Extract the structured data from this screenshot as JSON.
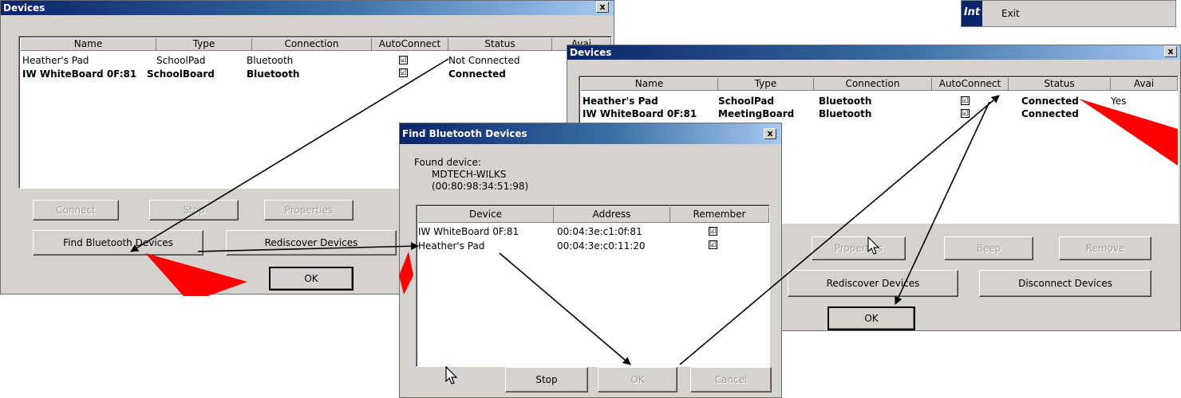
{
  "menu": {
    "strip_label": "Int",
    "item_label": "Exit"
  },
  "win1": {
    "title": "Devices",
    "close_glyph": "x",
    "columns": [
      "Name",
      "Type",
      "Connection",
      "AutoConnect",
      "Status",
      "Avai"
    ],
    "rows": [
      {
        "name": "Heather's Pad",
        "type": "SchoolPad",
        "connection": "Bluetooth",
        "auto": "☑",
        "status": "Not Connected",
        "bold": false
      },
      {
        "name": "IW WhiteBoard 0F:81",
        "type": "SchoolBoard",
        "connection": "Bluetooth",
        "auto": "☑",
        "status": "Connected",
        "bold": true
      }
    ],
    "buttons": {
      "connect": "Connect",
      "stop": "Stop",
      "properties": "Properties",
      "find": "Find Bluetooth Devices",
      "rediscover": "Rediscover Devices",
      "ok": "OK"
    }
  },
  "win2": {
    "title": "Devices",
    "close_glyph": "x",
    "columns": [
      "Name",
      "Type",
      "Connection",
      "AutoConnect",
      "Status",
      "Avai"
    ],
    "rows": [
      {
        "name": "Heather's Pad",
        "type": "SchoolPad",
        "connection": "Bluetooth",
        "auto": "☑",
        "status": "Connected",
        "avail": "Yes"
      },
      {
        "name": "IW WhiteBoard 0F:81",
        "type": "MeetingBoard",
        "connection": "Bluetooth",
        "auto": "☑",
        "status": "Connected",
        "avail": ""
      }
    ],
    "buttons": {
      "properties": "Properties",
      "beep": "Beep",
      "remove": "Remove",
      "rediscover": "Rediscover Devices",
      "disconnect": "Disconnect Devices",
      "ok": "OK"
    }
  },
  "win3": {
    "title": "Find Bluetooth Devices",
    "close_glyph": "x",
    "found_label": "Found device:",
    "found_name": "MDTECH-WILKS",
    "found_address": "(00:80:98:34:51:98)",
    "columns": [
      "Device",
      "Address",
      "Remember"
    ],
    "rows": [
      {
        "device": "IW WhiteBoard 0F:81",
        "address": "00:04:3e:c1:0f:81",
        "remember": "☑"
      },
      {
        "device": "Heather's Pad",
        "address": "00:04:3e:c0:11:20",
        "remember": "☑"
      }
    ],
    "buttons": {
      "stop": "Stop",
      "ok": "OK",
      "cancel": "Cancel"
    }
  },
  "colors": {
    "arrow_red": "#ff0000",
    "title_blue": "#0a246a",
    "dialog_gray": "#d6d3ce"
  }
}
